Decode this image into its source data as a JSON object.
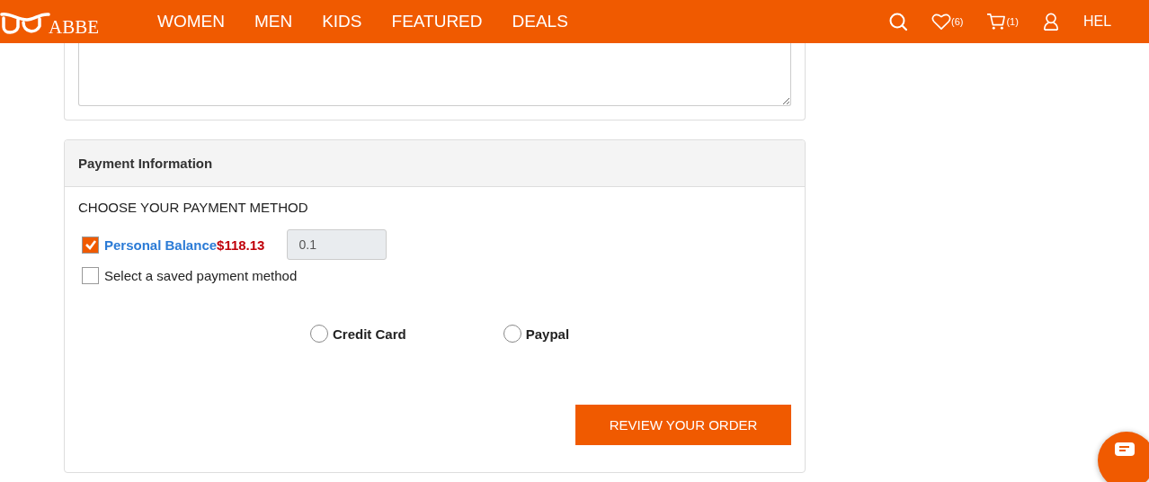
{
  "header": {
    "logo": "ABBE",
    "nav": [
      {
        "label": "WOMEN"
      },
      {
        "label": "MEN"
      },
      {
        "label": "KIDS"
      },
      {
        "label": "FEATURED"
      },
      {
        "label": "DEALS"
      }
    ],
    "wishlist_count": "(6)",
    "cart_count": "(1)",
    "account_link": "HEL"
  },
  "payment": {
    "title": "Payment Information",
    "heading": "CHOOSE YOUR PAYMENT METHOD",
    "options": [
      {
        "kind": "balance",
        "label": "Personal Balance",
        "amount": "$118.13",
        "value": "0.1",
        "checked": true
      },
      {
        "kind": "saved",
        "label": "Select a saved payment method",
        "checked": false
      }
    ],
    "methods": [
      {
        "label": "Credit Card",
        "selected": false
      },
      {
        "label": "Paypal",
        "selected": false
      }
    ],
    "submit": "REVIEW YOUR ORDER"
  }
}
